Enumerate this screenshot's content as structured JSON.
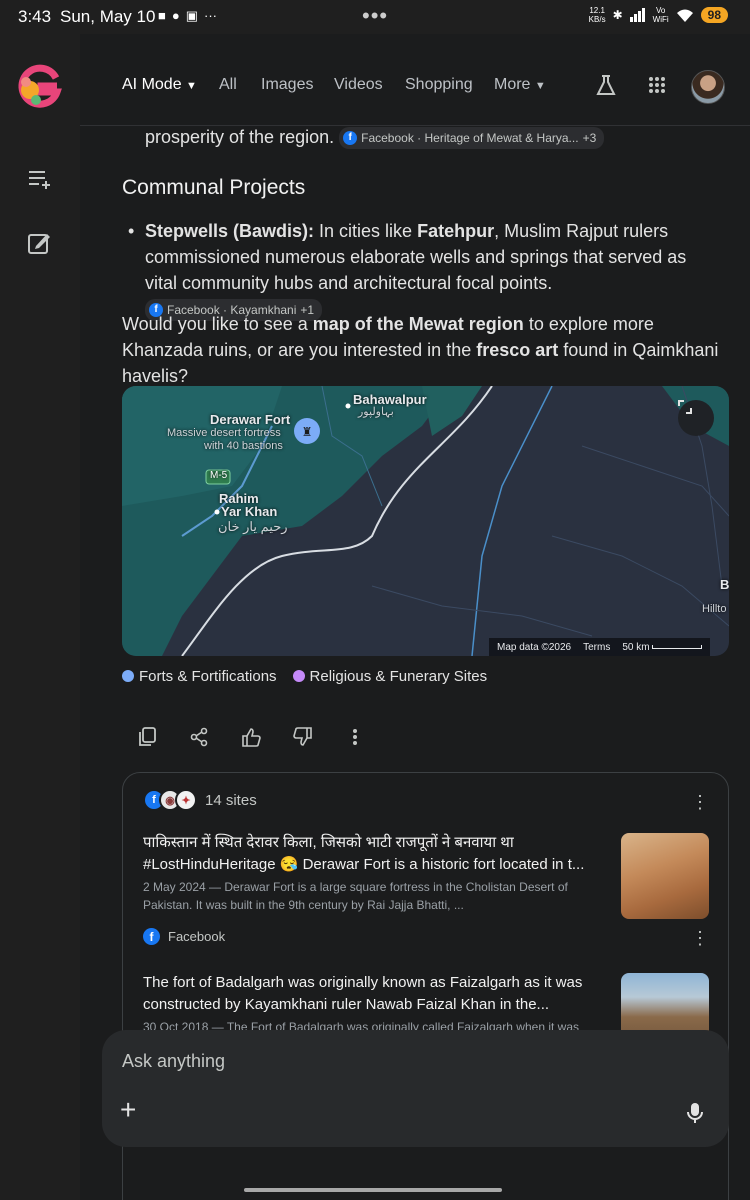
{
  "status_bar": {
    "time": "3:43",
    "date": "Sun, May 10",
    "dots": "•••",
    "net_rate": "12.1\nKB/s",
    "wifi_label": "Vo\nWiFi",
    "battery": "98"
  },
  "nav": {
    "tabs": [
      {
        "label": "AI Mode"
      },
      {
        "label": "All"
      },
      {
        "label": "Images"
      },
      {
        "label": "Videos"
      },
      {
        "label": "Shopping"
      },
      {
        "label": "More"
      }
    ]
  },
  "content": {
    "top_line": "prosperity of the region.",
    "top_citation": "Facebook · Heritage of Mewat & Harya...",
    "top_citation_more": "+3",
    "heading": "Communal Projects",
    "bullet_bold": "Stepwells (Bawdis):",
    "bullet_text_1": " In cities like ",
    "bullet_bold_2": "Fatehpur",
    "bullet_text_2": ", Muslim Rajput rulers commissioned numerous elaborate wells and springs that served as vital community hubs and architectural focal points.",
    "bullet_citation": "Facebook · Kayamkhani",
    "bullet_citation_more": "+1",
    "question_1": "Would you like to see a ",
    "question_bold_1": "map of the Mewat region",
    "question_2": " to explore more Khanzada ruins, or are you interested in the ",
    "question_bold_2": "fresco art",
    "question_3": " found in Qaimkhani havelis?"
  },
  "map": {
    "labels": {
      "bahawalpur": "Bahawalpur",
      "bahawalpur_urdu": "بہاولپور",
      "derawar": "Derawar Fort",
      "derawar_desc_1": "Massive desert fortress",
      "derawar_desc_2": "with 40 bastions",
      "motorway": "M-5",
      "rahim_1": "Rahim",
      "rahim_2": "Yar Khan",
      "rahim_urdu": "رحیم یار خان",
      "edge_b": "B",
      "hillto": "Hillto"
    },
    "attribution": "Map data ©2026",
    "terms": "Terms",
    "scale": "50 km"
  },
  "legend": [
    {
      "label": "Forts & Fortifications",
      "color": "#7cacf8"
    },
    {
      "label": "Religious & Funerary Sites",
      "color": "#c58af9"
    }
  ],
  "sources": {
    "count_label": "14 sites",
    "items": [
      {
        "title_1": "पाकिस्तान में स्थित देरावर किला, जिसको भाटी राजपूतों ने बनवाया था",
        "title_2": "#LostHinduHeritage 😪 Derawar Fort is a historic fort located in t...",
        "snippet": "2 May 2024 — Derawar Fort is a large square fortress in the Cholistan Desert of Pakistan. It was built in the 9th century by Rai Jajja Bhatti, ...",
        "site": "Facebook"
      },
      {
        "title_1": "The fort of Badalgarh was originally known as Faizalgarh as it was",
        "title_2": "constructed by Kayamkhani ruler Nawab Faizal Khan in the...",
        "snippet": "30 Oct 2018 — The Fort of Badalgarh was originally called Faizalgarh when it was"
      }
    ]
  },
  "ask": {
    "placeholder": "Ask anything",
    "plus": "+"
  }
}
